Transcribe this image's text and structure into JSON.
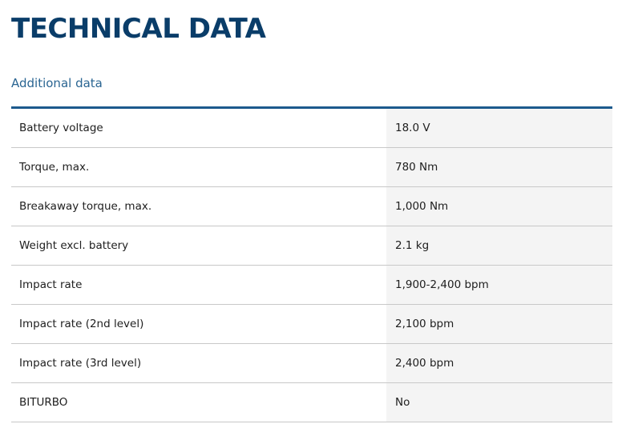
{
  "title": "TECHNICAL DATA",
  "section_link": "Additional data",
  "colors": {
    "title": "#0a3d69",
    "link": "#2a6592",
    "table_top_border": "#1c5a8d",
    "value_background": "#f4f4f4",
    "row_divider": "#c8c8c8"
  },
  "specs": [
    {
      "label": "Battery voltage",
      "value": "18.0 V"
    },
    {
      "label": "Torque, max.",
      "value": "780 Nm"
    },
    {
      "label": "Breakaway torque, max.",
      "value": "1,000 Nm"
    },
    {
      "label": "Weight excl. battery",
      "value": "2.1 kg"
    },
    {
      "label": "Impact rate",
      "value": "1,900-2,400 bpm"
    },
    {
      "label": "Impact rate (2nd level)",
      "value": "2,100 bpm"
    },
    {
      "label": "Impact rate (3rd level)",
      "value": "2,400 bpm"
    },
    {
      "label": "BITURBO",
      "value": "No"
    }
  ]
}
